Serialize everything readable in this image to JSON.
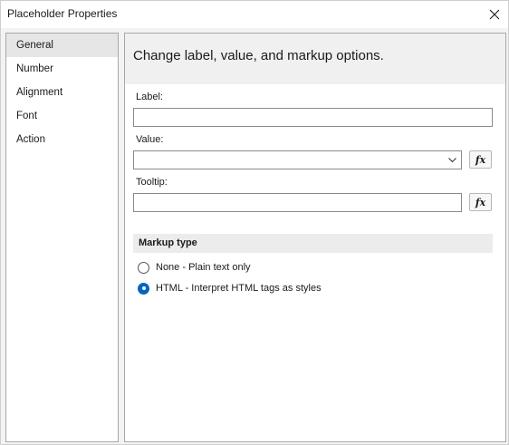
{
  "window": {
    "title": "Placeholder Properties"
  },
  "sidebar": {
    "items": [
      {
        "label": "General",
        "selected": true
      },
      {
        "label": "Number",
        "selected": false
      },
      {
        "label": "Alignment",
        "selected": false
      },
      {
        "label": "Font",
        "selected": false
      },
      {
        "label": "Action",
        "selected": false
      }
    ]
  },
  "main": {
    "header": "Change label, value, and markup options.",
    "label_field": {
      "label": "Label:",
      "value": "",
      "placeholder": ""
    },
    "value_field": {
      "label": "Value:",
      "value": "",
      "expression_button": "fx"
    },
    "tooltip_field": {
      "label": "Tooltip:",
      "value": "",
      "expression_button": "fx"
    },
    "markup": {
      "section_title": "Markup type",
      "options": [
        {
          "label": "None - Plain text only",
          "checked": false
        },
        {
          "label": "HTML - Interpret HTML tags as styles",
          "checked": true
        }
      ]
    }
  },
  "colors": {
    "accent": "#0067c0",
    "selected_item_bg": "#e6e6e6"
  }
}
